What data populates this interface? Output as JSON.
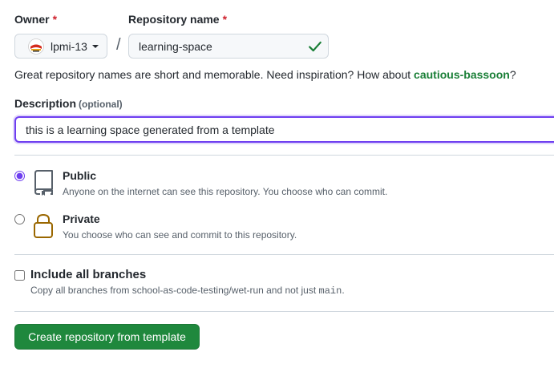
{
  "owner": {
    "label": "Owner",
    "required_mark": "*",
    "selected": "lpmi-13"
  },
  "repository": {
    "label": "Repository name",
    "required_mark": "*",
    "value": "learning-space",
    "separator": "/"
  },
  "hint": {
    "text": "Great repository names are short and memorable. Need inspiration? How about ",
    "suggestion": "cautious-bassoon",
    "end": "?"
  },
  "description": {
    "label": "Description",
    "optional": "(optional)",
    "value": "this is a learning space generated from a template"
  },
  "visibility": {
    "selected": "public",
    "public": {
      "title": "Public",
      "desc": "Anyone on the internet can see this repository. You choose who can commit."
    },
    "private": {
      "title": "Private",
      "desc": "You choose who can see and commit to this repository."
    }
  },
  "branches": {
    "title": "Include all branches",
    "checked": false,
    "desc_prefix": "Copy all branches from school-as-code-testing/wet-run and not just ",
    "desc_code": "main",
    "desc_suffix": "."
  },
  "submit": {
    "label": "Create repository from template"
  },
  "colors": {
    "accent_focus": "#6e3ef0",
    "success": "#1a7f37",
    "button": "#1f883d",
    "danger": "#cf222e",
    "lock": "#9a6700"
  }
}
